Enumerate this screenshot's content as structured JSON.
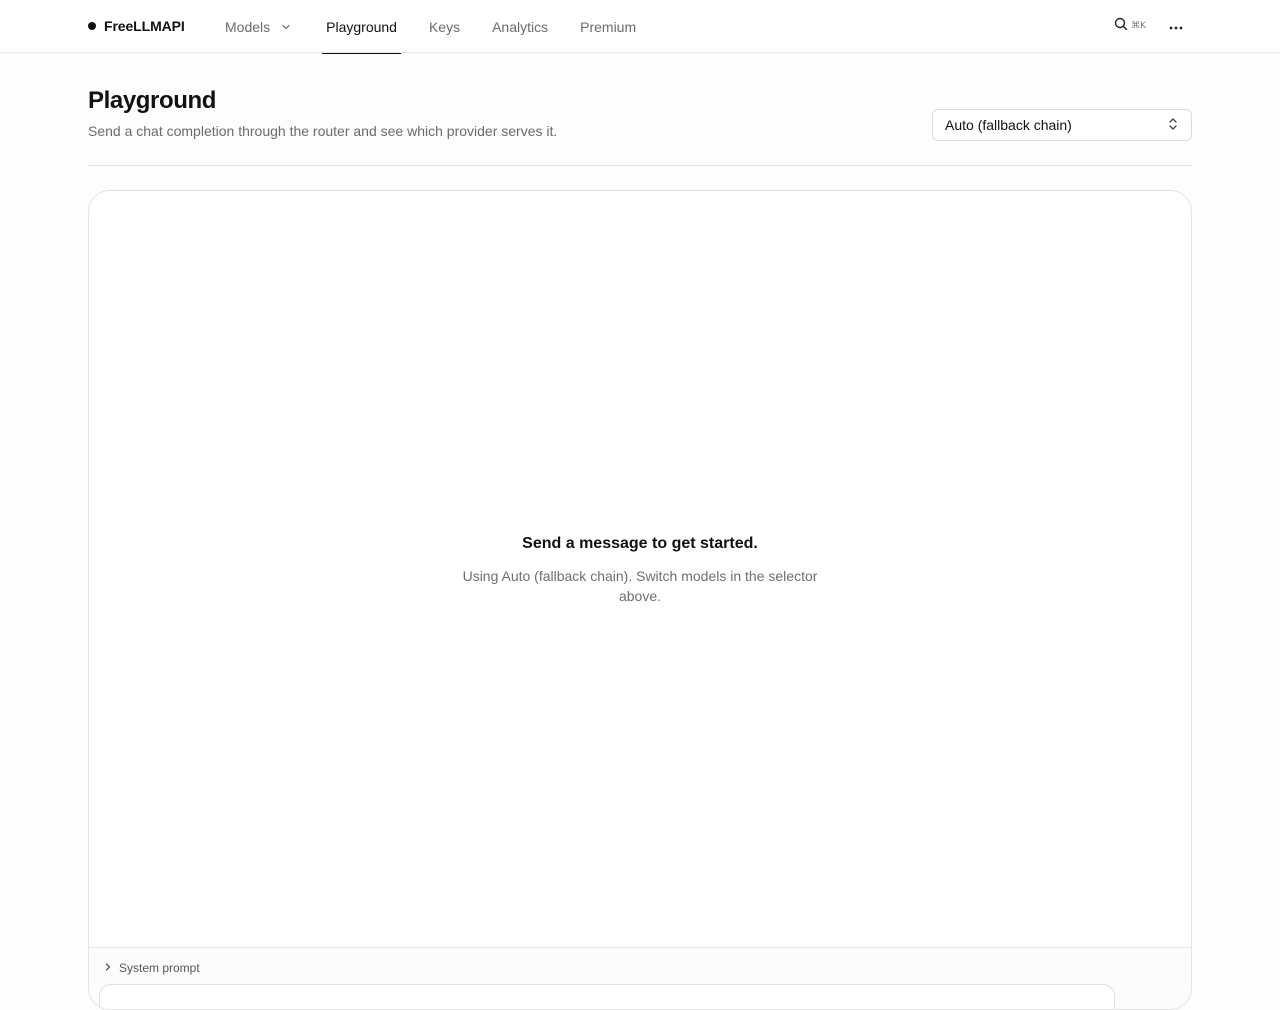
{
  "nav": {
    "brand": "FreeLLMAPI",
    "items": [
      {
        "label": "Models"
      },
      {
        "label": "Playground"
      },
      {
        "label": "Keys"
      },
      {
        "label": "Analytics"
      },
      {
        "label": "Premium"
      }
    ],
    "active": "Playground",
    "search_shortcut": "⌘K"
  },
  "header": {
    "title": "Playground",
    "subtitle": "Send a chat completion through the router and see which provider serves it.",
    "model_select": {
      "selected": "Auto (fallback chain)"
    }
  },
  "chat": {
    "empty_title": "Send a message to get started.",
    "empty_description": "Using Auto (fallback chain). Switch models in the selector above.",
    "system_prompt_label": "System prompt"
  },
  "icons": {
    "models_dropdown": "chevron-down-icon",
    "search": "search-icon",
    "more": "more-horizontal-icon",
    "select": "chevron-up-down-icon",
    "system_prompt_toggle": "chevron-right-icon"
  }
}
